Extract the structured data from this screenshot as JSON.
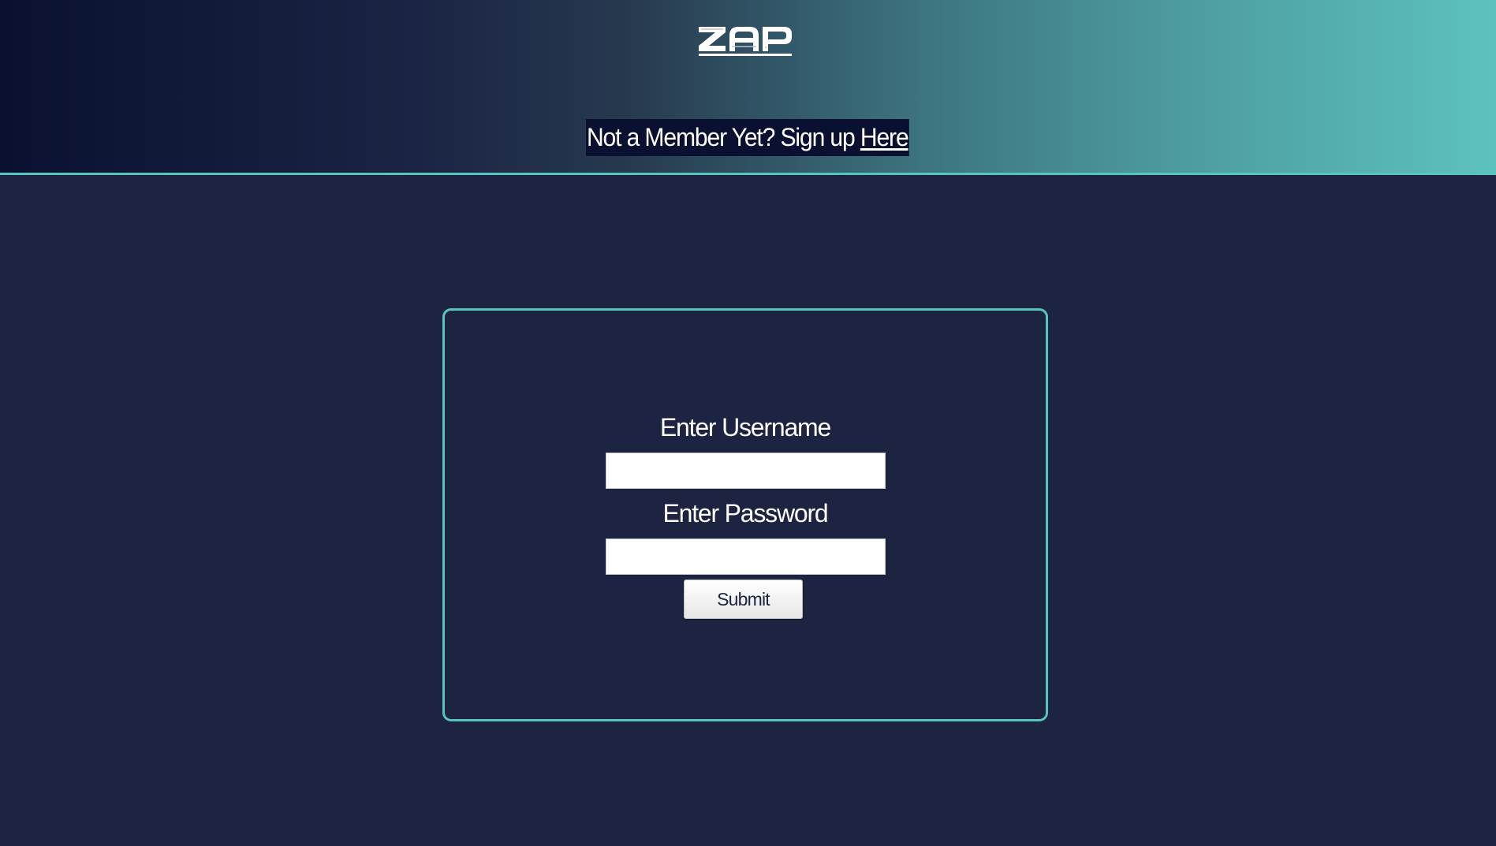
{
  "header": {
    "logo_text": "ZAP",
    "signup_prompt": "Not a Member Yet? Sign up ",
    "signup_link": "Here"
  },
  "login_form": {
    "username_label": "Enter Username",
    "username_value": "",
    "password_label": "Enter Password",
    "password_value": "",
    "submit_label": "Submit"
  },
  "colors": {
    "page_background": "#1c2442",
    "accent": "#58c5bd",
    "header_gradient_start": "#0a1130",
    "header_gradient_end": "#5dc2bd",
    "text": "#ffffff"
  }
}
